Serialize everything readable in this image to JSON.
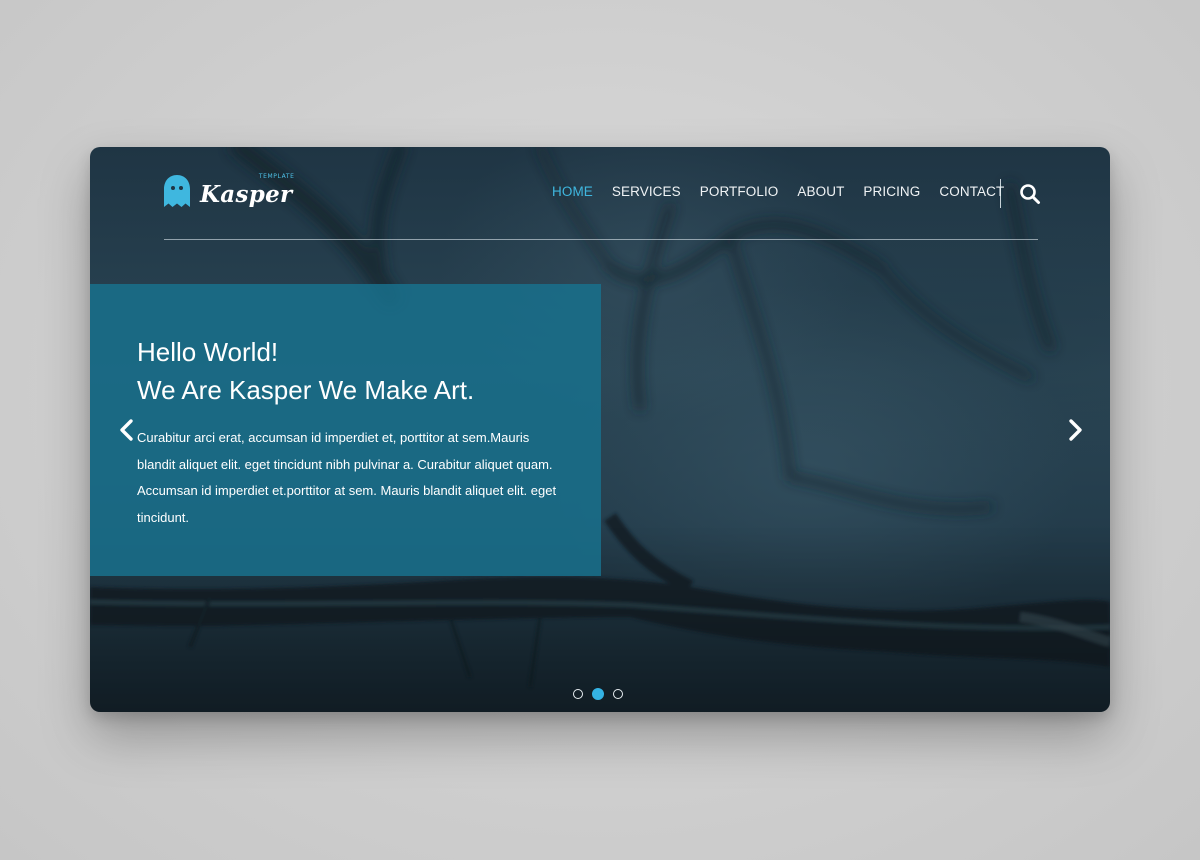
{
  "brand": {
    "name": "Kasper",
    "tagline": "TEMPLATE",
    "logo_icon": "ghost-icon",
    "accent_color": "#3fb7df"
  },
  "nav": {
    "items": [
      {
        "label": "HOME",
        "active": true
      },
      {
        "label": "SERVICES",
        "active": false
      },
      {
        "label": "PORTFOLIO",
        "active": false
      },
      {
        "label": "ABOUT",
        "active": false
      },
      {
        "label": "PRICING",
        "active": false
      },
      {
        "label": "CONTACT",
        "active": false
      }
    ],
    "search_icon": "search-icon"
  },
  "hero": {
    "title_line1": "Hello World!",
    "title_line2": "We Are Kasper We Make Art.",
    "paragraph": "Curabitur arci erat, accumsan id imperdiet et, porttitor at sem.Mauris blandit aliquet elit. eget tincidunt nibh pulvinar a. Curabitur aliquet quam. Accumsan id imperdiet et.porttitor at sem. Mauris blandit aliquet elit. eget tincidunt.",
    "caption_color": "#18708c",
    "prev_icon": "chevron-left-icon",
    "next_icon": "chevron-right-icon"
  },
  "slider": {
    "total_slides": 3,
    "active_slide": 2
  }
}
